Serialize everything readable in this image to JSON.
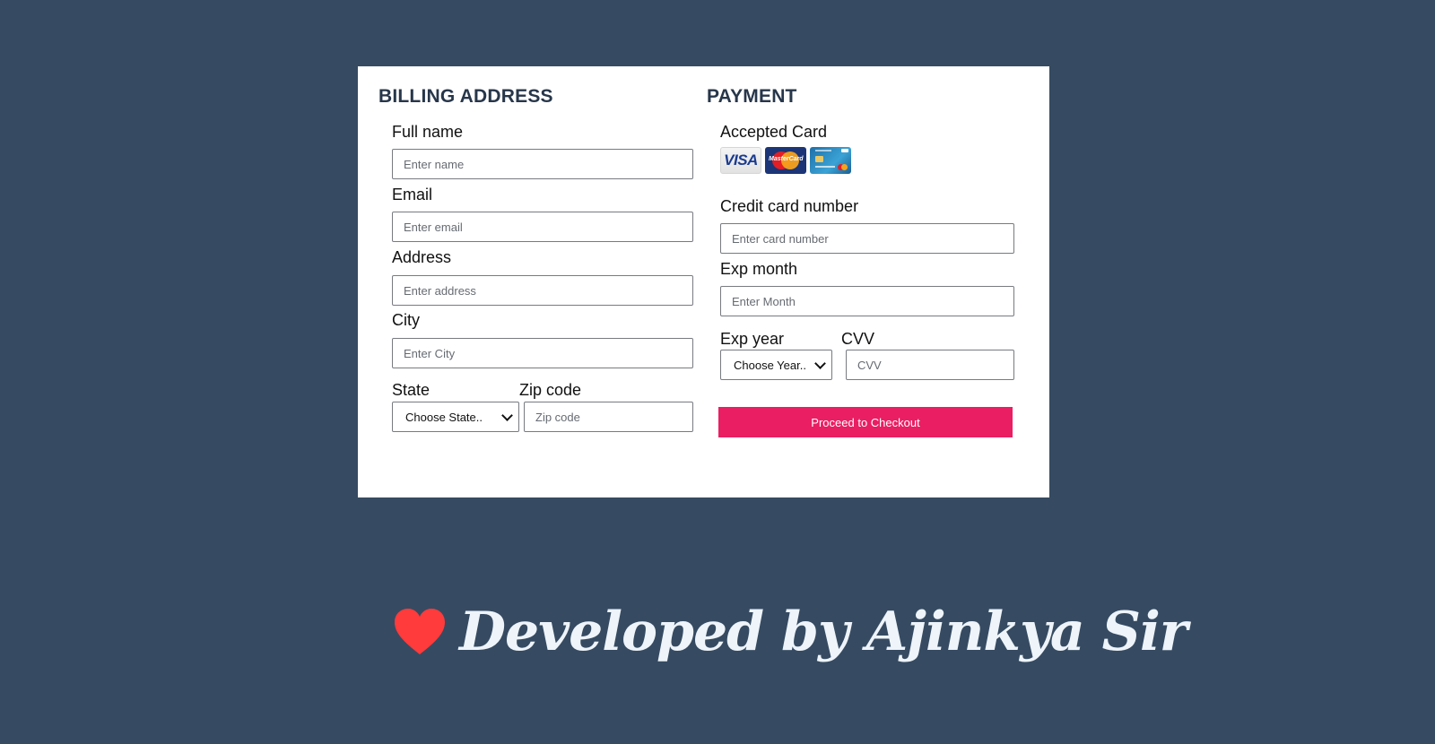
{
  "billing": {
    "title": "BILLING ADDRESS",
    "full_name": {
      "label": "Full name",
      "placeholder": "Enter name"
    },
    "email": {
      "label": "Email",
      "placeholder": "Enter email"
    },
    "address": {
      "label": "Address",
      "placeholder": "Enter address"
    },
    "city": {
      "label": "City",
      "placeholder": "Enter City"
    },
    "state": {
      "label": "State",
      "selected": "Choose State.."
    },
    "zip": {
      "label": "Zip code",
      "placeholder": "Zip code"
    }
  },
  "payment": {
    "title": "PAYMENT",
    "accepted_label": "Accepted Card",
    "cards": {
      "visa": {
        "text": "VISA",
        "icon": "visa-card-icon"
      },
      "mastercard": {
        "text": "MasterCard",
        "icon": "mastercard-card-icon"
      },
      "generic": {
        "icon": "generic-credit-card-icon"
      }
    },
    "card_number": {
      "label": "Credit card number",
      "placeholder": "Enter card number"
    },
    "exp_month": {
      "label": "Exp month",
      "placeholder": "Enter Month"
    },
    "exp_year": {
      "label": "Exp year",
      "selected": "Choose Year.."
    },
    "cvv": {
      "label": "CVV",
      "placeholder": "CVV"
    },
    "checkout_label": "Proceed to Checkout"
  },
  "footer": {
    "icon": "heart-icon",
    "text": "Developed by Ajinkya Sir"
  },
  "colors": {
    "background": "#364b62",
    "card": "#ffffff",
    "heading": "#27364a",
    "button": "#e91e63",
    "heart": "#ff3b3b",
    "footer_text": "#eef4fa"
  }
}
